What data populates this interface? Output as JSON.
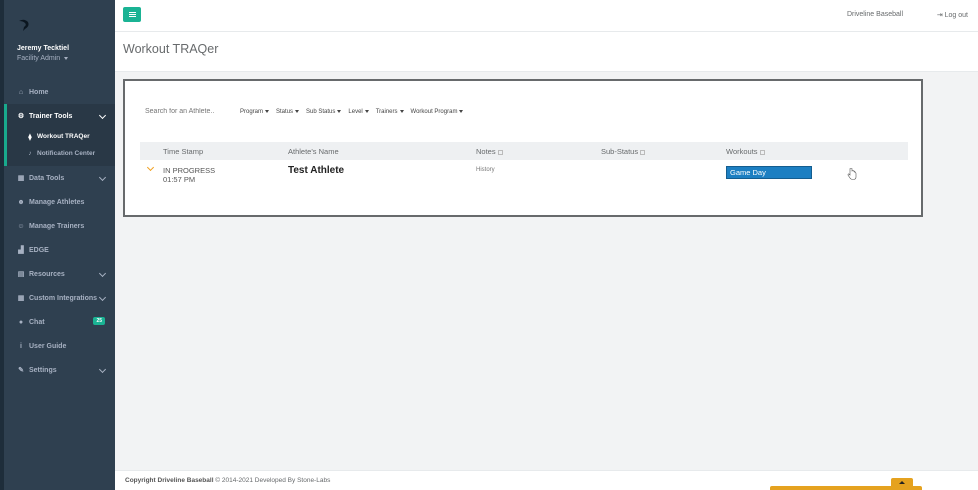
{
  "sidebar": {
    "user_name": "Jeremy Tecktiel",
    "user_role": "Facility Admin",
    "items": [
      {
        "label": "Home",
        "icon": "home-icon"
      },
      {
        "label": "Trainer Tools",
        "icon": "tools-icon"
      },
      {
        "label": "Workout TRAQer",
        "icon": "pin-icon"
      },
      {
        "label": "Notification Center",
        "icon": "bell-icon"
      },
      {
        "label": "Data Tools",
        "icon": "table-icon"
      },
      {
        "label": "Manage Athletes",
        "icon": "users-icon"
      },
      {
        "label": "Manage Trainers",
        "icon": "user-plus-icon"
      },
      {
        "label": "EDGE",
        "icon": "chart-icon"
      },
      {
        "label": "Resources",
        "icon": "book-icon"
      },
      {
        "label": "Custom Integrations",
        "icon": "grid-icon"
      },
      {
        "label": "Chat",
        "icon": "chat-icon",
        "badge": "25"
      },
      {
        "label": "User Guide",
        "icon": "info-icon"
      },
      {
        "label": "Settings",
        "icon": "wrench-icon"
      }
    ]
  },
  "topbar": {
    "org_name": "Driveline Baseball",
    "logout_label": "Log out"
  },
  "page": {
    "title": "Workout TRAQer"
  },
  "filters": {
    "search_placeholder": "Search for an Athlete..",
    "items": [
      "Program",
      "Status",
      "Sub Status",
      "Level",
      "Trainers",
      "Workout Program"
    ]
  },
  "table": {
    "columns": [
      "Time Stamp",
      "Athlete's Name",
      "Notes",
      "Sub-Status",
      "Workouts"
    ],
    "rows": [
      {
        "status": "IN PROGRESS",
        "time": "01:57 PM",
        "athlete": "Test Athlete",
        "notes": "History",
        "sub_status": "",
        "workout": "Game Day"
      }
    ]
  },
  "footer": {
    "copyright_bold": "Copyright Driveline Baseball",
    "copyright_rest": " © 2014-2021 Developed By Stone-Labs"
  },
  "colors": {
    "sidebar_bg": "#2f4050",
    "accent": "#1ab394",
    "workout_button": "#1c7fc2",
    "expand_chevron": "#f0a020"
  }
}
